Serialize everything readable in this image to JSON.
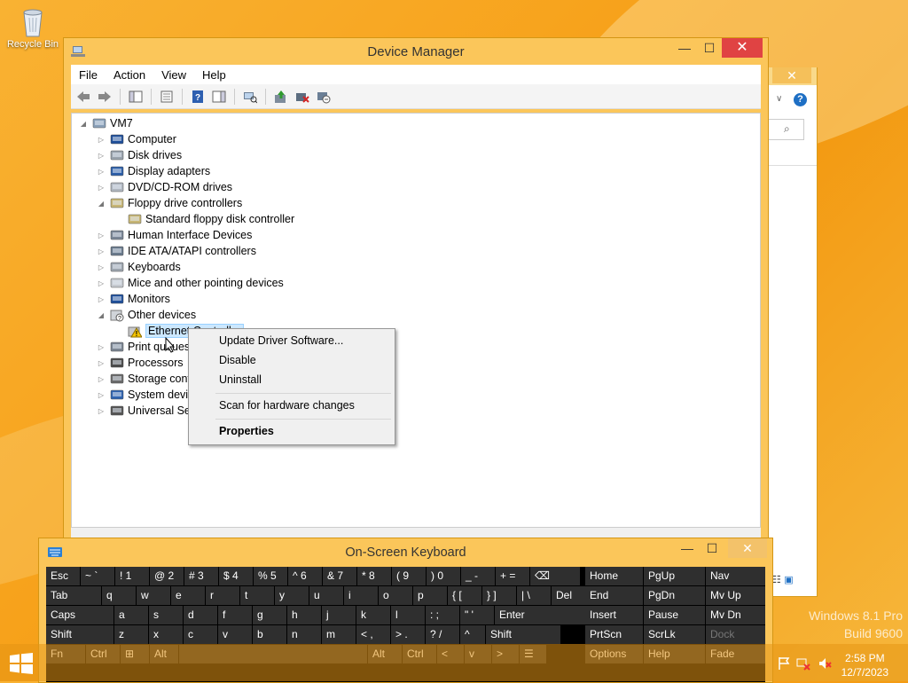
{
  "desktop": {
    "recycle_bin": "Recycle Bin",
    "watermark": [
      "Windows 8.1 Pro",
      "Build 9600"
    ],
    "clock": {
      "time": "2:58 PM",
      "date": "12/7/2023"
    }
  },
  "device_manager": {
    "title": "Device Manager",
    "menu": [
      "File",
      "Action",
      "View",
      "Help"
    ],
    "tree": [
      {
        "label": "VM7",
        "level": 0,
        "state": "expanded",
        "icon": "computer-root-icon"
      },
      {
        "label": "Computer",
        "level": 1,
        "state": "collapsed",
        "icon": "monitor-icon"
      },
      {
        "label": "Disk drives",
        "level": 1,
        "state": "collapsed",
        "icon": "disk-drive-icon"
      },
      {
        "label": "Display adapters",
        "level": 1,
        "state": "collapsed",
        "icon": "display-adapter-icon"
      },
      {
        "label": "DVD/CD-ROM drives",
        "level": 1,
        "state": "collapsed",
        "icon": "dvd-drive-icon"
      },
      {
        "label": "Floppy drive controllers",
        "level": 1,
        "state": "expanded",
        "icon": "floppy-controller-icon"
      },
      {
        "label": "Standard floppy disk controller",
        "level": 2,
        "state": "leaf",
        "icon": "floppy-controller-icon"
      },
      {
        "label": "Human Interface Devices",
        "level": 1,
        "state": "collapsed",
        "icon": "hid-icon"
      },
      {
        "label": "IDE ATA/ATAPI controllers",
        "level": 1,
        "state": "collapsed",
        "icon": "ide-controller-icon"
      },
      {
        "label": "Keyboards",
        "level": 1,
        "state": "collapsed",
        "icon": "keyboard-icon"
      },
      {
        "label": "Mice and other pointing devices",
        "level": 1,
        "state": "collapsed",
        "icon": "mouse-icon"
      },
      {
        "label": "Monitors",
        "level": 1,
        "state": "collapsed",
        "icon": "monitor-icon"
      },
      {
        "label": "Other devices",
        "level": 1,
        "state": "expanded",
        "icon": "unknown-device-icon"
      },
      {
        "label": "Ethernet Controller",
        "level": 2,
        "state": "leaf",
        "icon": "warning-device-icon",
        "selected": true
      },
      {
        "label": "Print queues",
        "level": 1,
        "state": "collapsed",
        "icon": "printer-icon"
      },
      {
        "label": "Processors",
        "level": 1,
        "state": "collapsed",
        "icon": "processor-icon"
      },
      {
        "label": "Storage controllers",
        "level": 1,
        "state": "collapsed",
        "icon": "storage-controller-icon"
      },
      {
        "label": "System devices",
        "level": 1,
        "state": "collapsed",
        "icon": "system-device-icon"
      },
      {
        "label": "Universal Serial Bus controllers",
        "level": 1,
        "state": "collapsed",
        "icon": "usb-icon"
      }
    ]
  },
  "context_menu": {
    "items": [
      {
        "label": "Update Driver Software...",
        "bold": false
      },
      {
        "label": "Disable",
        "bold": false
      },
      {
        "label": "Uninstall",
        "bold": false
      },
      {
        "label": "Scan for hardware changes",
        "bold": false
      },
      {
        "label": "Properties",
        "bold": true
      }
    ]
  },
  "osk": {
    "title": "On-Screen Keyboard",
    "rows": [
      [
        "Esc",
        "~ `",
        "! 1",
        "@ 2",
        "# 3",
        "$ 4",
        "% 5",
        "^ 6",
        "& 7",
        "* 8",
        "( 9",
        ") 0",
        "_ -",
        "+ =",
        "⌫"
      ],
      [
        "Tab",
        "q",
        "w",
        "e",
        "r",
        "t",
        "y",
        "u",
        "i",
        "o",
        "p",
        "{ [",
        "} ]",
        "| \\",
        "Del"
      ],
      [
        "Caps",
        "a",
        "s",
        "d",
        "f",
        "g",
        "h",
        "j",
        "k",
        "l",
        ": ;",
        "\" '",
        "Enter"
      ],
      [
        "Shift",
        "z",
        "x",
        "c",
        "v",
        "b",
        "n",
        "m",
        "< ,",
        "> .",
        "? /",
        "^",
        "Shift"
      ],
      [
        "Fn",
        "Ctrl",
        "⊞",
        "Alt",
        "",
        "Alt",
        "Ctrl",
        "<",
        "v",
        ">",
        "☰"
      ]
    ],
    "nav": [
      [
        "Home",
        "PgUp",
        "Nav"
      ],
      [
        "End",
        "PgDn",
        "Mv Up"
      ],
      [
        "Insert",
        "Pause",
        "Mv Dn"
      ],
      [
        "PrtScn",
        "ScrLk",
        "Dock"
      ],
      [
        "Options",
        "Help",
        "Fade"
      ]
    ]
  }
}
